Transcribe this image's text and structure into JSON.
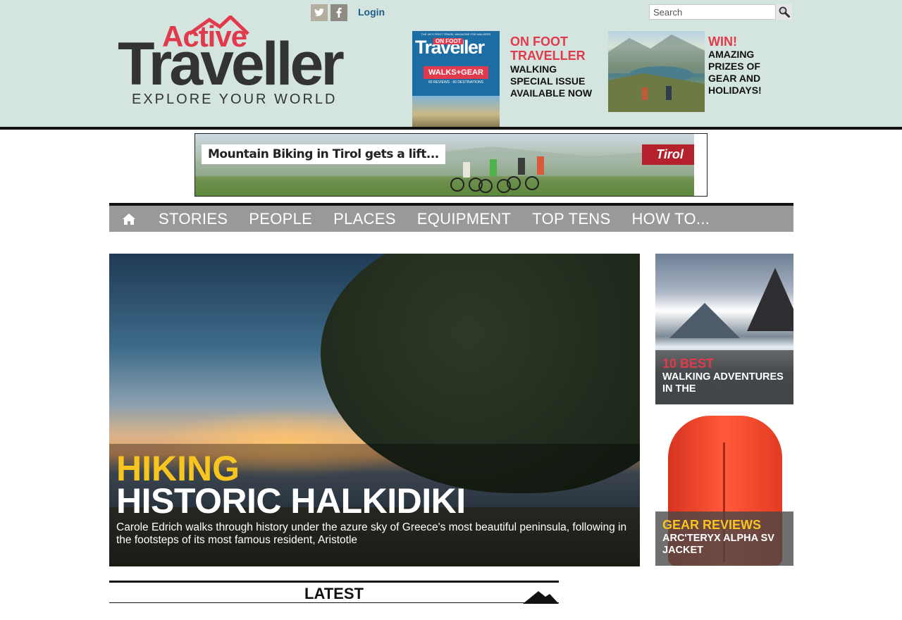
{
  "header": {
    "login_label": "Login",
    "search_placeholder": "Search",
    "logo": {
      "word_top": "Active",
      "word_main": "Traveller",
      "tagline": "EXPLORE YOUR WORLD"
    },
    "promos": [
      {
        "title": "ON FOOT TRAVELLER",
        "text": "WALKING SPECIAL ISSUE AVAILABLE NOW",
        "cover": {
          "top_line": "THE UK'S FIRST TRAVEL MAGAZINE FOR WALKERS",
          "badge": "ON FOOT",
          "brand": "Traveller",
          "strap": "WALKS+GEAR",
          "sub": "60 REVIEWS · 60 DESTINATIONS"
        }
      },
      {
        "title": "WIN!",
        "text": "AMAZING PRIZES OF GEAR AND HOLIDAYS!"
      }
    ],
    "colors": {
      "band": "#d4e4de",
      "accent_red": "#e23a4d",
      "link_blue": "#1f5d8a"
    }
  },
  "banner": {
    "label": "Mountain Biking in Tirol gets a lift...",
    "brand": "Tirol"
  },
  "nav": {
    "home_icon": "home-icon",
    "items": [
      "STORIES",
      "PEOPLE",
      "PLACES",
      "EQUIPMENT",
      "TOP TENS",
      "HOW TO..."
    ]
  },
  "hero": {
    "kicker": "HIKING",
    "title": "HISTORIC HALKIDIKI",
    "description": "Carole Edrich walks through history under the azure sky of Greece's most beautiful peninsula, following in the footsteps of its most famous resident, Aristotle"
  },
  "side_cards": [
    {
      "kicker": "10 BEST",
      "text": "WALKING ADVENTURES IN THE"
    },
    {
      "kicker": "GEAR REVIEWS",
      "text": "ARC'TERYX ALPHA SV JACKET"
    }
  ],
  "latest": {
    "label": "LATEST"
  }
}
